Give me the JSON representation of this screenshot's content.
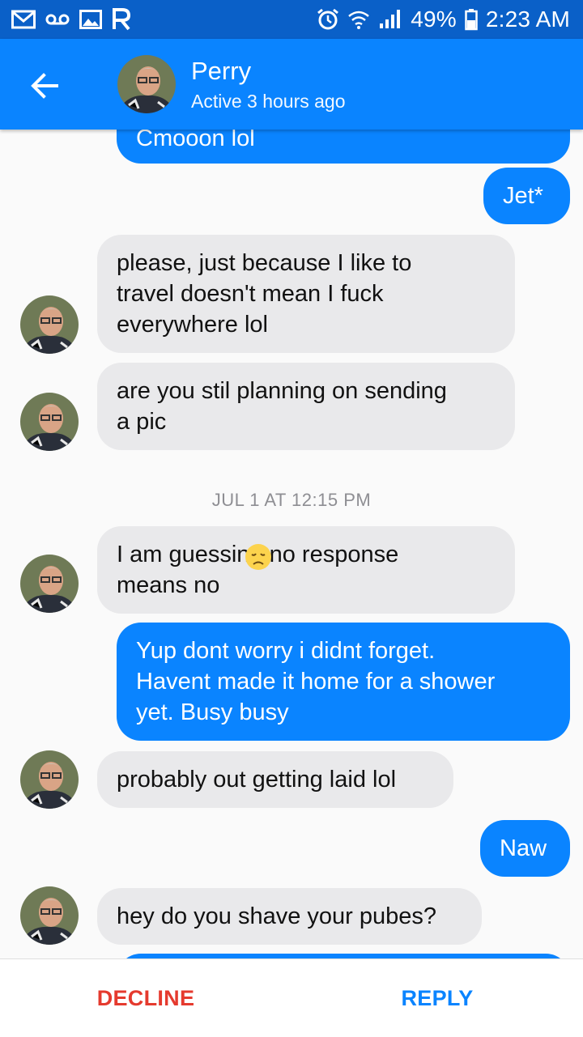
{
  "status_bar": {
    "battery": "49%",
    "time": "2:23 AM",
    "icons": [
      "gmail-icon",
      "voicemail-icon",
      "gallery-icon",
      "app-r-icon",
      "alarm-icon",
      "wifi-icon",
      "signal-icon",
      "battery-icon"
    ]
  },
  "header": {
    "name": "Perry",
    "status": "Active 3 hours ago"
  },
  "messages": [
    {
      "from": "me",
      "text": "Cmooon lol"
    },
    {
      "from": "me",
      "text": "Jet*"
    },
    {
      "from": "them",
      "text": "please, just because I like to\ntravel doesn't mean I fuck\neverywhere  lol"
    },
    {
      "from": "them",
      "text": "are you stil planning on sending\na pic"
    },
    {
      "timestamp": "JUL 1 AT 12:15 PM"
    },
    {
      "from": "them",
      "text": "I am guessing no response\nmeans no",
      "emoji": "disappointed-face-icon"
    },
    {
      "from": "me",
      "text": "Yup dont worry i didnt forget.\nHavent made it home for a shower\nyet. Busy busy"
    },
    {
      "from": "them",
      "text": "probably out getting laid  lol"
    },
    {
      "from": "me",
      "text": "Naw"
    },
    {
      "from": "them",
      "text": "hey do you shave your pubes?"
    }
  ],
  "actions": {
    "decline": "DECLINE",
    "reply": "REPLY"
  },
  "colors": {
    "status_bar": "#0a60c8",
    "header": "#0a84ff",
    "sent_bubble": "#0a84ff",
    "received_bubble": "#e9e9eb",
    "decline": "#e53a2e",
    "reply": "#0a84ff"
  }
}
